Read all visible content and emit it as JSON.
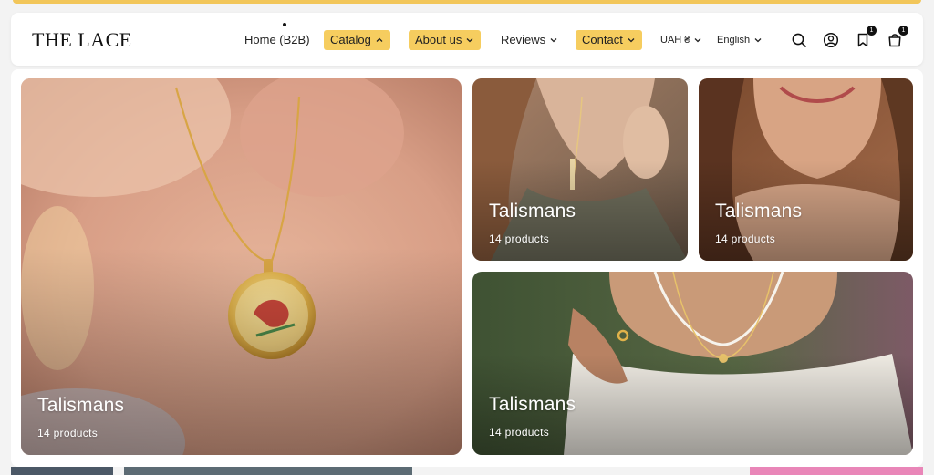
{
  "brand": {
    "logo": "THE LACE"
  },
  "nav": {
    "home": "Home (B2B)",
    "catalog": "Catalog",
    "about": "About us",
    "reviews": "Reviews",
    "contact": "Contact",
    "currency": "UAH ₴",
    "language": "English"
  },
  "header_icons": {
    "wishlist_count": "1",
    "cart_count": "1"
  },
  "catalog_menu": {
    "cards": [
      {
        "title": "Talismans",
        "count": "14 products"
      },
      {
        "title": "Talismans",
        "count": "14 products"
      },
      {
        "title": "Talismans",
        "count": "14 products"
      },
      {
        "title": "Talismans",
        "count": "14 products"
      }
    ]
  },
  "colors": {
    "accent": "#f6cd5f",
    "text": "#1a1a1a",
    "panel": "#ffffff"
  }
}
